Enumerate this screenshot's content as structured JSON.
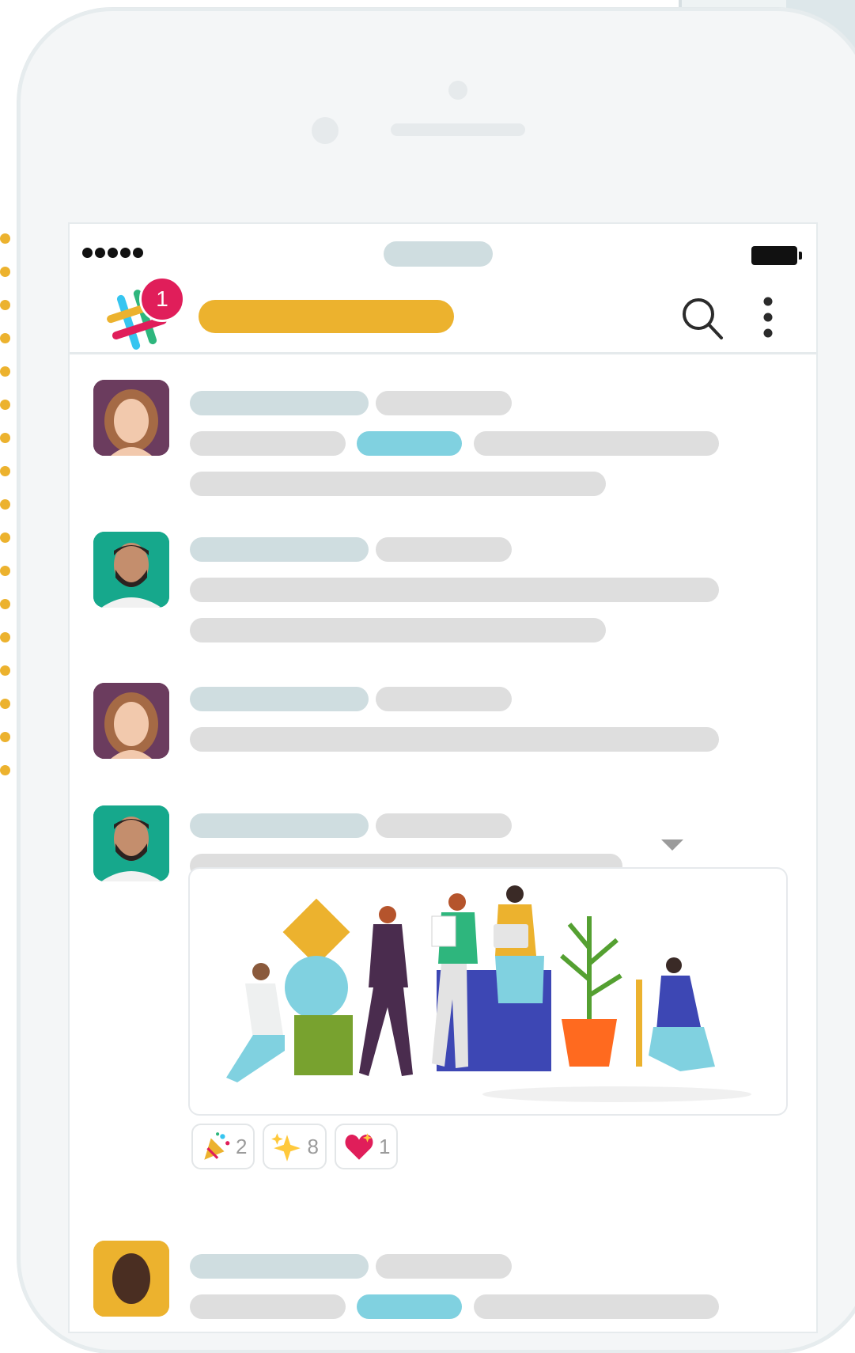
{
  "header": {
    "notification_count": "1",
    "icons": {
      "logo": "slack-hash-logo",
      "search": "search-icon",
      "more": "more-vertical-icon"
    }
  },
  "colors": {
    "brand_yellow": "#ecb22e",
    "badge_red": "#e01e5a",
    "name_placeholder": "#cfdde0",
    "text_placeholder": "#dedede",
    "link_placeholder": "#80d1e0"
  },
  "messages": [
    {
      "avatar": "woman-avatar"
    },
    {
      "avatar": "bearded-man-avatar"
    },
    {
      "avatar": "woman-avatar"
    },
    {
      "avatar": "bearded-man-avatar",
      "attachment": "team-illustration"
    },
    {
      "avatar": "man-avatar-yellow"
    }
  ],
  "reactions": [
    {
      "emoji": "party-popper-icon",
      "count": "2"
    },
    {
      "emoji": "sparkles-icon",
      "count": "8"
    },
    {
      "emoji": "sparkling-heart-icon",
      "count": "1"
    }
  ]
}
